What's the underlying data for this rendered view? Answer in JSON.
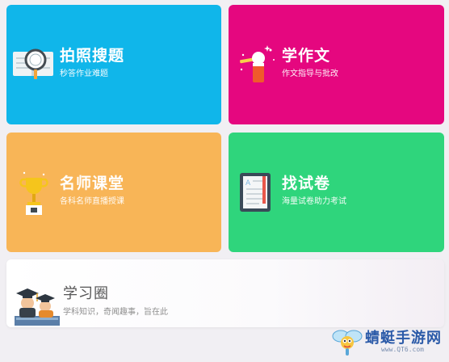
{
  "tiles": [
    {
      "title": "拍照搜题",
      "subtitle": "秒答作业难题",
      "icon": "magnifier-book-icon",
      "color": "#10b6ea"
    },
    {
      "title": "学作文",
      "subtitle": "作文指导与批改",
      "icon": "pencil-hand-icon",
      "color": "#e5077f"
    },
    {
      "title": "名师课堂",
      "subtitle": "各科名师直播授课",
      "icon": "trophy-icon",
      "color": "#f8b557"
    },
    {
      "title": "找试卷",
      "subtitle": "海量试卷助力考试",
      "icon": "exam-paper-icon",
      "color": "#2fd57c"
    },
    {
      "title": "学习圈",
      "subtitle": "学科知识，奇闻趣事，旨在此",
      "icon": "graduation-caps-icon",
      "color": "#ffffff"
    }
  ],
  "watermark": {
    "text": "蜻蜓手游网",
    "url": "www.QT6.com",
    "icon": "dragonfly-logo-icon"
  }
}
